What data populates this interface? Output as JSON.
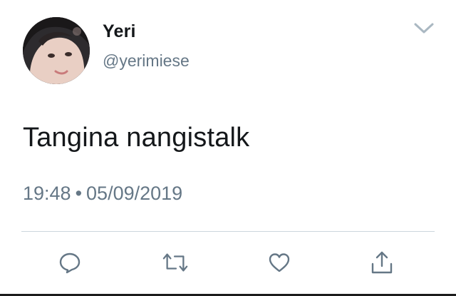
{
  "tweet": {
    "author_name": "Yeri",
    "author_handle": "@yerimiese",
    "text": "Tangina nangistalk",
    "time": "19:48",
    "separator": "•",
    "date": "05/09/2019"
  },
  "icons": {
    "menu": "chevron-down-icon",
    "reply": "reply-icon",
    "retweet": "retweet-icon",
    "like": "heart-icon",
    "share": "share-icon"
  },
  "colors": {
    "text_primary": "#14171a",
    "text_secondary": "#657786",
    "icon": "#657786",
    "divider": "#ccd6dd"
  }
}
